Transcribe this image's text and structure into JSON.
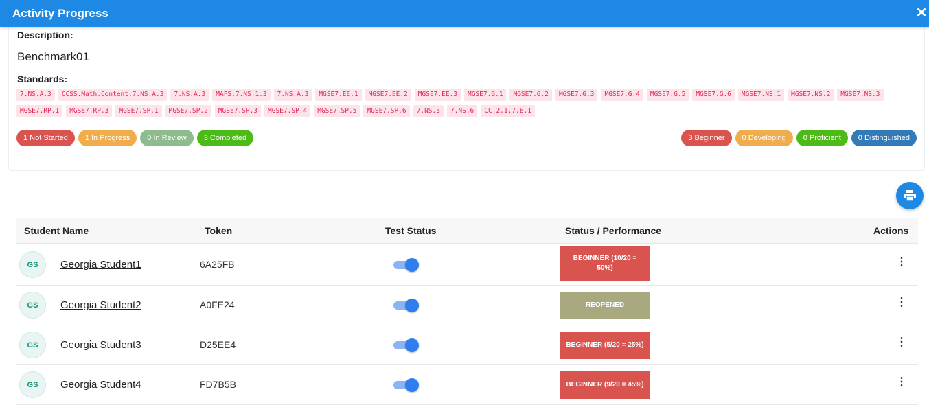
{
  "header": {
    "title": "Activity Progress",
    "close_symbol": "✕"
  },
  "card": {
    "description_label": "Description:",
    "description_value": "Benchmark01",
    "standards_label": "Standards:",
    "standards": [
      "7.NS.A.3",
      "CCSS.Math.Content.7.NS.A.3",
      "7.NS.A.3",
      "MAFS.7.NS.1.3",
      "7.NS.A.3",
      "MGSE7.EE.1",
      "MGSE7.EE.2",
      "MGSE7.EE.3",
      "MGSE7.G.1",
      "MGSE7.G.2",
      "MGSE7.G.3",
      "MGSE7.G.4",
      "MGSE7.G.5",
      "MGSE7.G.6",
      "MGSE7.NS.1",
      "MGSE7.NS.2",
      "MGSE7.NS.3",
      "MGSE7.RP.1",
      "MGSE7.RP.3",
      "MGSE7.SP.1",
      "MGSE7.SP.2",
      "MGSE7.SP.3",
      "MGSE7.SP.4",
      "MGSE7.SP.5",
      "MGSE7.SP.6",
      "7.NS.3",
      "7.NS.6",
      "CC.2.1.7.E.1"
    ],
    "progress_pills": [
      {
        "label": "1 Not Started",
        "color": "#d9534f"
      },
      {
        "label": "1 In Progress",
        "color": "#f0ad4e"
      },
      {
        "label": "0 In Review",
        "color": "#8fbc8f"
      },
      {
        "label": "3 Completed",
        "color": "#4cbb17"
      }
    ],
    "performance_pills": [
      {
        "label": "3 Beginner",
        "color": "#d9534f"
      },
      {
        "label": "0 Developing",
        "color": "#f0ad4e"
      },
      {
        "label": "0 Proficient",
        "color": "#4cbb17"
      },
      {
        "label": "0 Distinguished",
        "color": "#337ab7"
      }
    ]
  },
  "table": {
    "headers": {
      "name": "Student Name",
      "token": "Token",
      "test_status": "Test Status",
      "status": "Status / Performance",
      "actions": "Actions"
    },
    "rows": [
      {
        "initials": "GS",
        "name": "Georgia Student1",
        "token": "6A25FB",
        "status": "BEGINNER (10/20 = 50%)",
        "status_color": "#d9534f"
      },
      {
        "initials": "GS",
        "name": "Georgia Student2",
        "token": "A0FE24",
        "status": "REOPENED",
        "status_color": "#a8a97f"
      },
      {
        "initials": "GS",
        "name": "Georgia Student3",
        "token": "D25EE4",
        "status": "BEGINNER (5/20 = 25%)",
        "status_color": "#d9534f"
      },
      {
        "initials": "GS",
        "name": "Georgia Student4",
        "token": "FD7B5B",
        "status": "BEGINNER (9/20 = 45%)",
        "status_color": "#d9534f"
      }
    ],
    "actions_symbol": "⋮"
  },
  "colors": {
    "primary": "#1e88e5",
    "tag_bg": "#fde4ea",
    "tag_text": "#e02a58"
  }
}
